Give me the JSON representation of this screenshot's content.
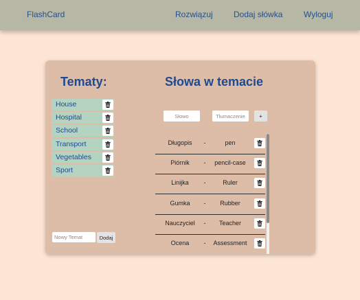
{
  "navbar": {
    "brand": "FlashCard",
    "links": [
      "Rozwiązuj",
      "Dodaj słówka",
      "Wyloguj"
    ],
    "background": "#b7b7a6"
  },
  "colors": {
    "page_background": "#fde5d6",
    "card_background": "#debda8",
    "heading_color": "#1d4a90",
    "topic_row_background": "#b5d3c1"
  },
  "topics": {
    "heading": "Tematy:",
    "items": [
      "House",
      "Hospital",
      "School",
      "Transport",
      "Vegetables",
      "Sport"
    ],
    "delete_icon": "trash-icon",
    "new_topic_placeholder": "Nowy Temat",
    "add_button": "Dodaj"
  },
  "words": {
    "heading": "Słowa w temacie",
    "word_placeholder": "Słowo",
    "translation_placeholder": "Tłumaczenie",
    "add_button": "+",
    "separator": "-",
    "delete_icon": "trash-icon",
    "items": [
      {
        "word": "Długopis",
        "translation": "pen"
      },
      {
        "word": "Piórnik",
        "translation": "pencil-case"
      },
      {
        "word": "Linijka",
        "translation": "Ruler"
      },
      {
        "word": "Gumka",
        "translation": "Rubber"
      },
      {
        "word": "Nauczyciel",
        "translation": "Teacher"
      },
      {
        "word": "Ocena",
        "translation": "Assessment"
      }
    ]
  }
}
